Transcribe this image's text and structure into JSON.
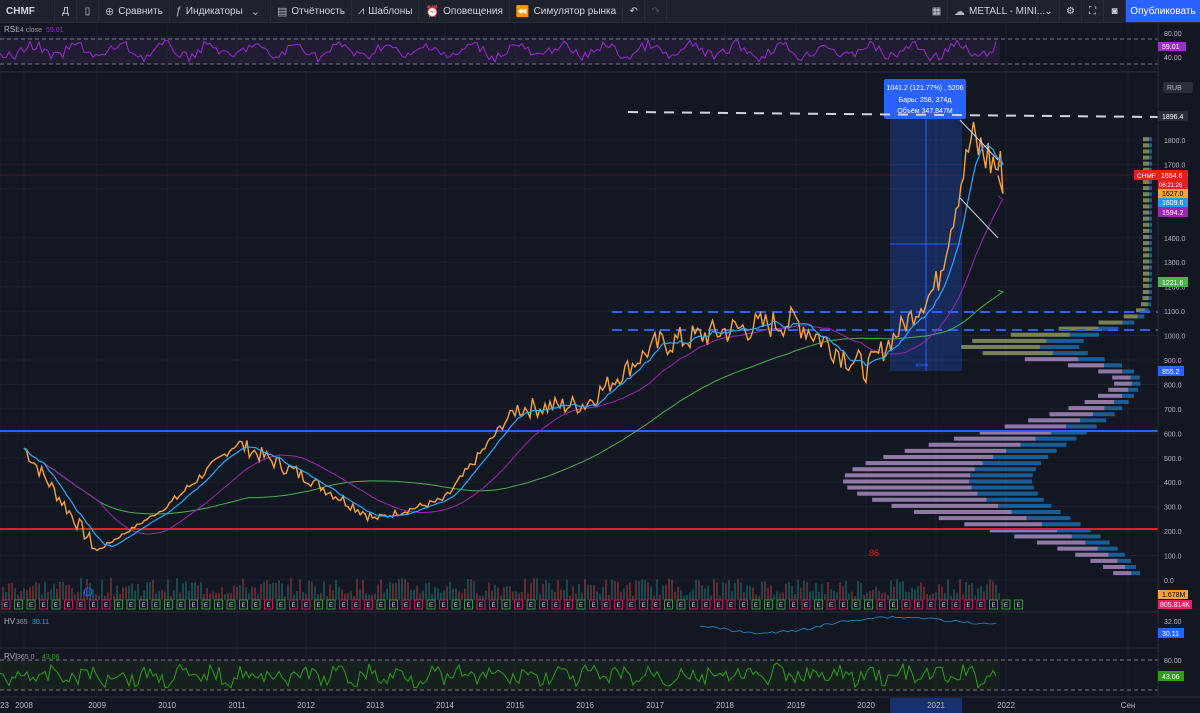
{
  "toolbar": {
    "symbol": "CHMF",
    "interval": "Д",
    "compare": "Сравнить",
    "indicators": "Индикаторы",
    "reports": "Отчётность",
    "templates": "Шаблоны",
    "alerts": "Оповещения",
    "replay": "Симулятор рынка",
    "watchlist": "METALL - MINI...",
    "publish": "Опубликовать"
  },
  "rsi_pane": {
    "label": "RSI",
    "params": "14 close",
    "value": "59.01",
    "scale": [
      "80.00",
      "60.00",
      "40.00"
    ]
  },
  "main_pane": {
    "currency": "RUB",
    "scale": [
      "1800.0",
      "1700.0",
      "1600.0",
      "1400.0",
      "1300.0",
      "1200.0",
      "1100.0",
      "1000.0",
      "900.0",
      "800.0",
      "700.0",
      "600.0",
      "500.0",
      "400.0",
      "300.0",
      "200.0",
      "100.0",
      "0.0"
    ],
    "price_tags": {
      "top_level": "1896.4",
      "symbol": "CHMF",
      "last": "1654.6",
      "countdown": "06:21:26",
      "ma_orange": "1627.0",
      "ma_blue": "1609.6",
      "ma_purple": "1594.2",
      "ma_green": "1221.6",
      "support": "855.2"
    },
    "range_tooltip": {
      "line1": "1041.2 (121.77%) , 5206",
      "line2": "Бары: 258, 374д",
      "line3": "Объём 347.847M"
    },
    "annotation": "86",
    "dividend_marker": "D",
    "earnings_marker": "E",
    "volume_tags": [
      "1.678M",
      "805.814K"
    ]
  },
  "hv_pane": {
    "label": "HV",
    "params": "365",
    "value": "30.11",
    "scale": [
      "32.00",
      "30.11"
    ]
  },
  "rvi_pane": {
    "label": "RVI",
    "params": "365 0",
    "value": "43.06",
    "scale": [
      "80.00",
      "43.06"
    ]
  },
  "time_axis": [
    "2008",
    "2009",
    "2010",
    "2011",
    "2012",
    "2013",
    "2014",
    "2015",
    "2016",
    "2017",
    "2018",
    "2019",
    "2020",
    "2021",
    "2022",
    "2023",
    "Сен"
  ],
  "chart_data": {
    "type": "line",
    "title": "",
    "x": [
      "2008",
      "2009",
      "2010",
      "2011",
      "2012",
      "2013",
      "2014",
      "2015",
      "2016",
      "2017",
      "2018",
      "2019",
      "2020",
      "2021",
      "2021.5",
      "2022"
    ],
    "series": [
      {
        "name": "",
        "values": [
          540,
          120,
          300,
          560,
          420,
          250,
          330,
          700,
          720,
          960,
          1020,
          1060,
          860,
          1200,
          1800,
          1655
        ]
      }
    ],
    "ylim": [
      0,
      1900
    ],
    "ylabel": "RUB",
    "grid": true,
    "log_scale": false
  },
  "colors": {
    "background": "#131722",
    "candle": "#f6a33f",
    "ma_blue": "#29a8ff",
    "ma_purple": "#9c27b0",
    "ma_green": "#4caf50",
    "line_red": "#e91e1e",
    "line_blue": "#2962ff",
    "rsi": "#9c2bd4",
    "rvi": "#2e9e1a"
  }
}
